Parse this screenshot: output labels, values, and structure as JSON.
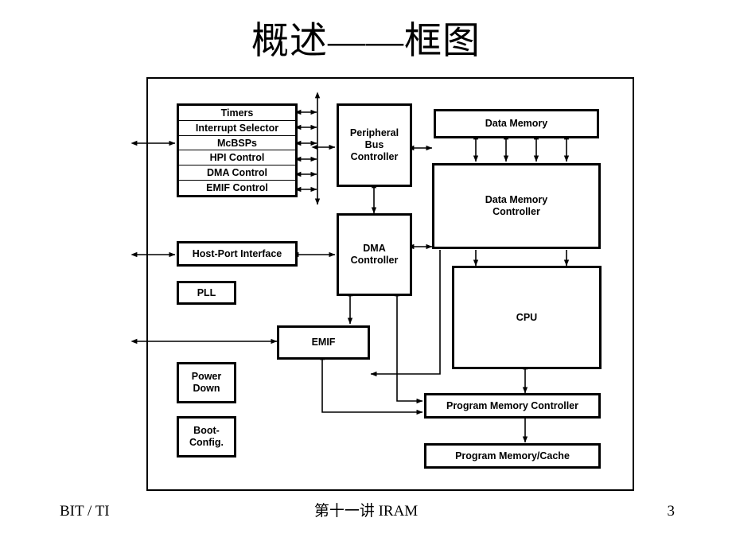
{
  "slide": {
    "title": "概述——框图",
    "page_number": "3"
  },
  "footer": {
    "left": "BIT / TI",
    "center": "第十一讲 IRAM",
    "right": "3"
  },
  "diagram": {
    "frame_label": "chip-boundary",
    "peripheral_stack": {
      "name": "peripheral-stack",
      "rows": [
        {
          "label": "Timers"
        },
        {
          "label": "Interrupt Selector"
        },
        {
          "label": "McBSPs"
        },
        {
          "label": "HPI Control"
        },
        {
          "label": "DMA Control"
        },
        {
          "label": "EMIF Control"
        }
      ]
    },
    "blocks": [
      {
        "id": "peripheral-bus-controller",
        "label": "Peripheral\nBus\nController"
      },
      {
        "id": "data-memory",
        "label": "Data Memory"
      },
      {
        "id": "data-memory-controller",
        "label": "Data Memory\nController"
      },
      {
        "id": "dma-controller",
        "label": "DMA\nController"
      },
      {
        "id": "host-port-interface",
        "label": "Host-Port Interface"
      },
      {
        "id": "pll",
        "label": "PLL"
      },
      {
        "id": "emif",
        "label": "EMIF"
      },
      {
        "id": "cpu",
        "label": "CPU"
      },
      {
        "id": "power-down",
        "label": "Power\nDown"
      },
      {
        "id": "boot-config",
        "label": "Boot-\nConfig."
      },
      {
        "id": "program-memory-controller",
        "label": "Program Memory Controller"
      },
      {
        "id": "program-memory-cache",
        "label": "Program Memory/Cache"
      }
    ],
    "colors": {
      "line": "#000000",
      "background": "#ffffff",
      "text": "#000000"
    }
  }
}
